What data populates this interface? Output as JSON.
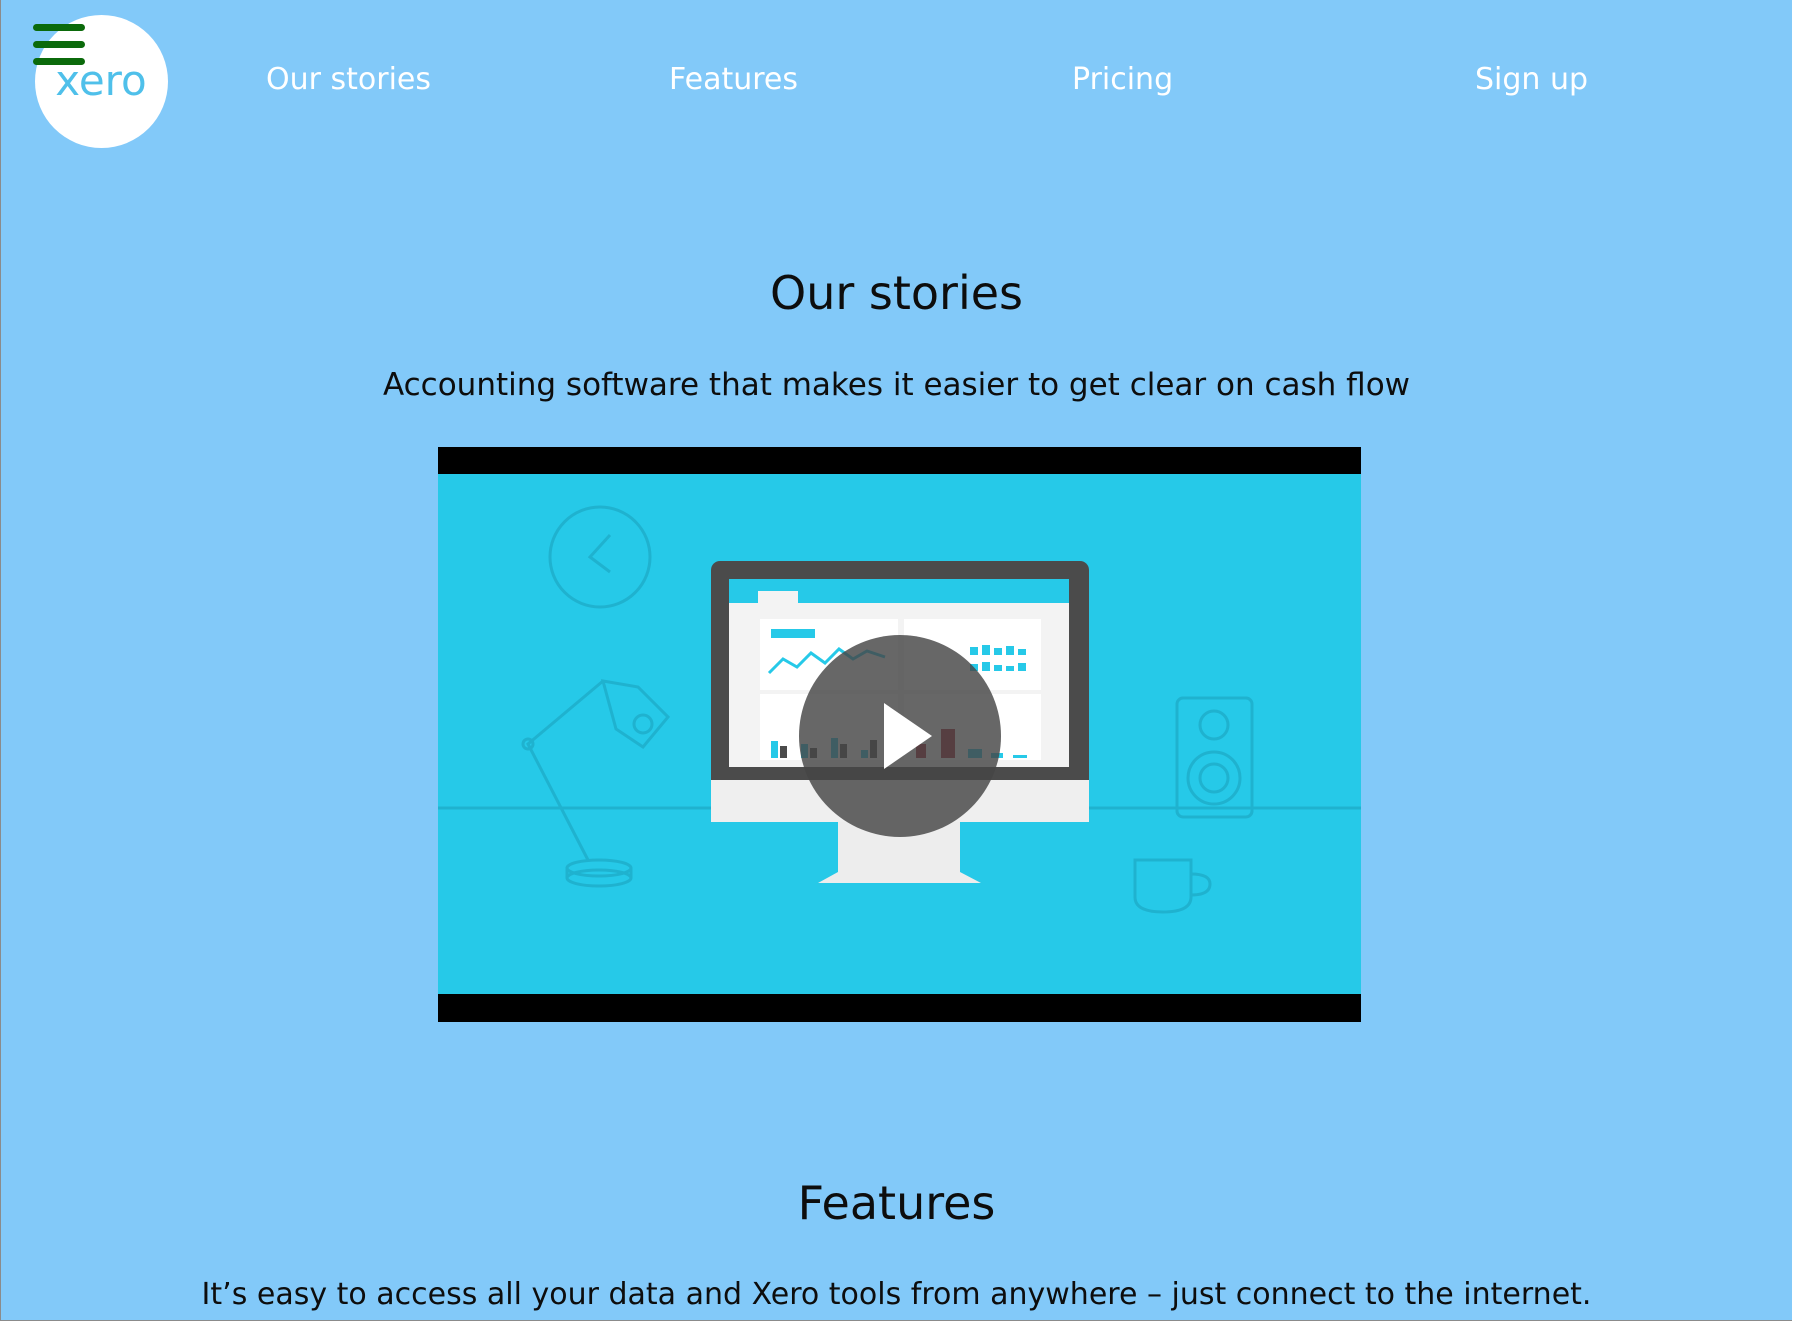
{
  "logo": {
    "text": "xero"
  },
  "nav": {
    "menu_icon": "hamburger-menu-icon",
    "links": [
      "Our stories",
      "Features",
      "Pricing",
      "Sign up"
    ]
  },
  "stories": {
    "title": "Our stories",
    "subtitle": "Accounting software that makes it easier to get clear on cash flow",
    "video": {
      "play_icon": "play-icon"
    }
  },
  "features": {
    "title": "Features",
    "subtitle": "It’s easy to access all your data and Xero tools from anywhere – just connect to the internet."
  },
  "colors": {
    "background": "#82c9f9",
    "video_bg": "#26c9e8",
    "menu_icon": "#0b6a0b",
    "nav_text": "#ffffff"
  }
}
